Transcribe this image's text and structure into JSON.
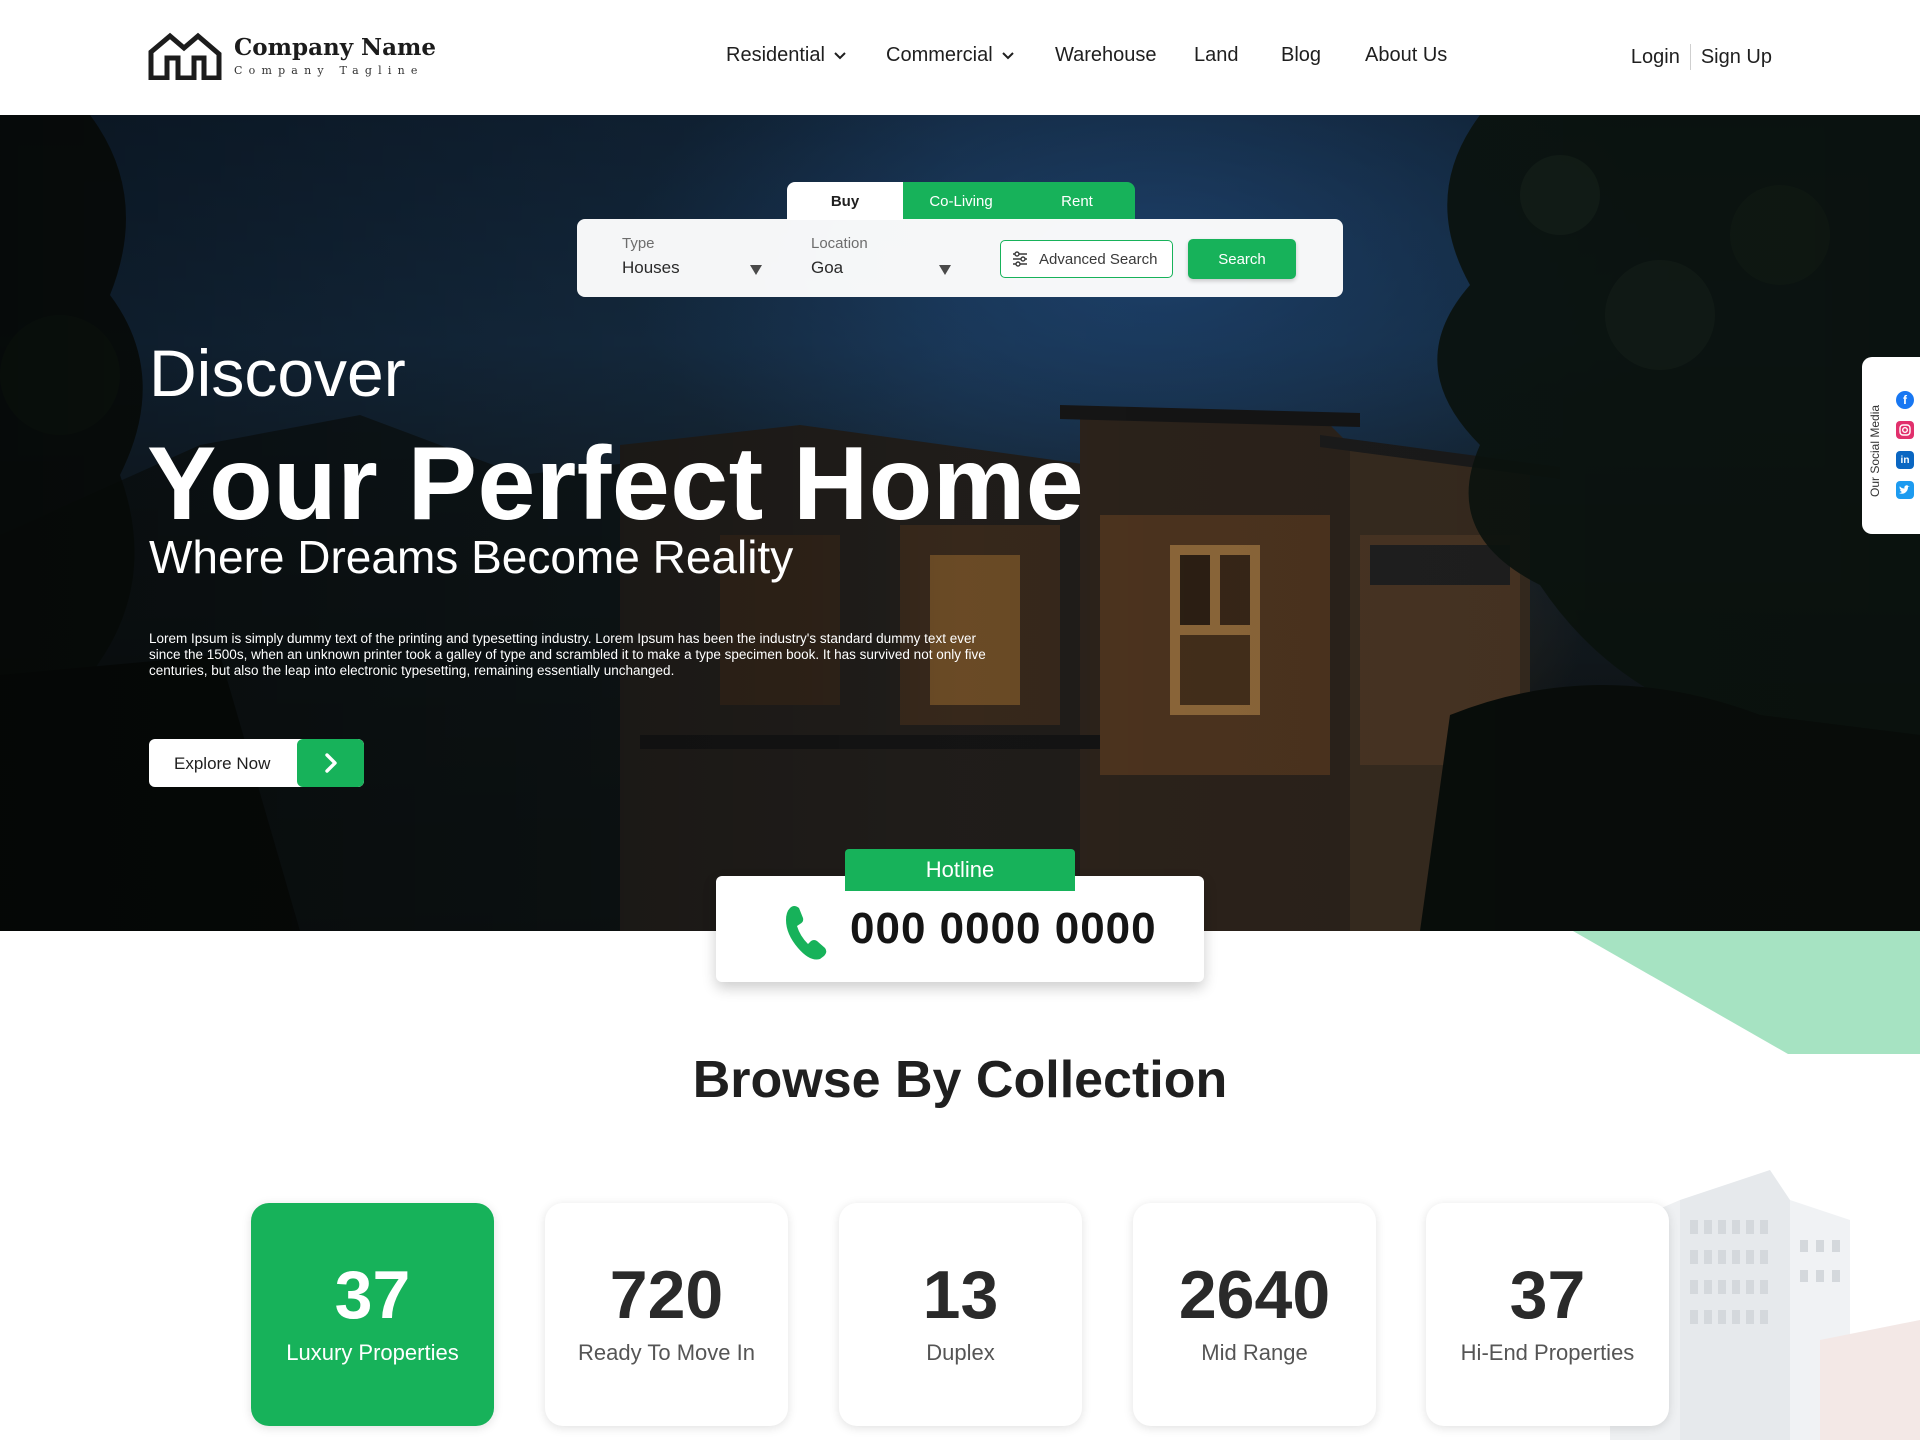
{
  "brand": {
    "name": "Company Name",
    "tagline": "Company Tagline"
  },
  "nav": {
    "items": [
      {
        "label": "Residential",
        "dropdown": true
      },
      {
        "label": "Commercial",
        "dropdown": true
      },
      {
        "label": "Warehouse",
        "dropdown": false
      },
      {
        "label": "Land",
        "dropdown": false
      },
      {
        "label": "Blog",
        "dropdown": false
      },
      {
        "label": "About Us",
        "dropdown": false
      }
    ],
    "login": "Login",
    "signup": "Sign Up"
  },
  "search": {
    "tabs": [
      "Buy",
      "Co-Living",
      "Rent"
    ],
    "active_tab": "Buy",
    "type_label": "Type",
    "type_value": "Houses",
    "location_label": "Location",
    "location_value": "Goa",
    "advanced_label": "Advanced Search",
    "search_label": "Search"
  },
  "hero": {
    "discover": "Discover",
    "title": "Your Perfect Home",
    "subtitle": "Where Dreams Become Reality",
    "paragraph": "Lorem Ipsum is simply dummy text of the printing and typesetting industry. Lorem Ipsum has been the industry's standard dummy text ever since the 1500s, when an unknown printer took a galley of type and scrambled it to make a type specimen book. It has survived not only five centuries, but also the leap into electronic typesetting, remaining essentially unchanged.",
    "cta": "Explore Now"
  },
  "social": {
    "label": "Our Social Media",
    "icons": [
      "facebook-icon",
      "instagram-icon",
      "linkedin-icon",
      "twitter-icon"
    ]
  },
  "hotline": {
    "label": "Hotline",
    "number": "000 0000 0000"
  },
  "browse": {
    "title": "Browse By Collection",
    "cards": [
      {
        "count": "37",
        "label": "Luxury Properties",
        "active": true
      },
      {
        "count": "720",
        "label": "Ready To Move In",
        "active": false
      },
      {
        "count": "13",
        "label": "Duplex",
        "active": false
      },
      {
        "count": "2640",
        "label": "Mid Range",
        "active": false
      },
      {
        "count": "37",
        "label": "Hi-End Properties",
        "active": false
      }
    ]
  },
  "colors": {
    "accent": "#17b25a",
    "accent_light": "#a6e3c2",
    "text": "#1f1f1f"
  }
}
